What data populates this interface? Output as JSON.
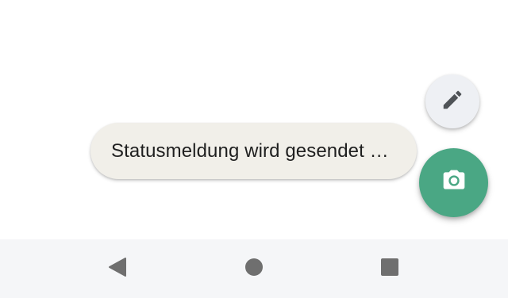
{
  "toast": {
    "message": "Statusmeldung wird gesendet …"
  },
  "fab_edit": {
    "icon": "pencil-icon"
  },
  "fab_camera": {
    "icon": "camera-icon",
    "color": "#4aa784"
  },
  "navigation_bar": {
    "back_icon": "back-triangle-icon",
    "home_icon": "home-circle-icon",
    "recents_icon": "recents-square-icon"
  },
  "colors": {
    "toast_background": "#f1efe9",
    "edit_fab_background": "#eef0f4",
    "camera_fab_background": "#4aa784",
    "navbar_background": "#f5f6f8",
    "nav_icon_color": "#6f6f6f"
  }
}
